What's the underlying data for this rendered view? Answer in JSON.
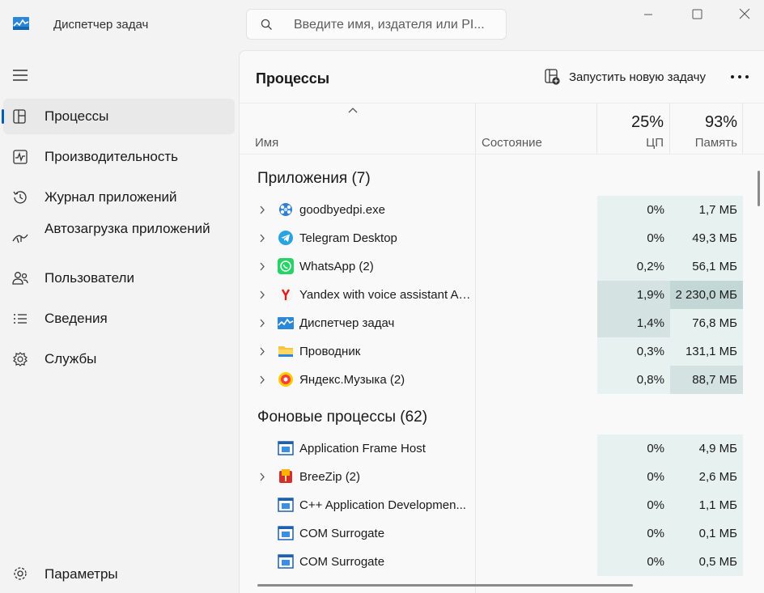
{
  "window": {
    "title": "Диспетчер задач",
    "search_placeholder": "Введите имя, издателя или PI..."
  },
  "sidebar": {
    "items": [
      {
        "label": "Процессы",
        "icon": "processes-icon",
        "active": true
      },
      {
        "label": "Производительность",
        "icon": "performance-icon"
      },
      {
        "label": "Журнал приложений",
        "icon": "app-history-icon"
      },
      {
        "label": "Автозагрузка приложений",
        "icon": "startup-icon"
      },
      {
        "label": "Пользователи",
        "icon": "users-icon"
      },
      {
        "label": "Сведения",
        "icon": "details-icon"
      },
      {
        "label": "Службы",
        "icon": "services-icon"
      }
    ],
    "settings_label": "Параметры"
  },
  "main": {
    "title": "Процессы",
    "run_task_label": "Запустить новую задачу",
    "columns": {
      "name": "Имя",
      "status": "Состояние",
      "cpu_percent": "25%",
      "cpu_label": "ЦП",
      "mem_percent": "93%",
      "mem_label": "Память"
    },
    "groups": {
      "apps": "Приложения (7)",
      "background": "Фоновые процессы (62)"
    },
    "apps": [
      {
        "name": "goodbyedpi.exe",
        "cpu": "0%",
        "mem": "1,7 МБ",
        "icon": "goodbyedpi-icon"
      },
      {
        "name": "Telegram Desktop",
        "cpu": "0%",
        "mem": "49,3 МБ",
        "icon": "telegram-icon"
      },
      {
        "name": "WhatsApp (2)",
        "cpu": "0,2%",
        "mem": "56,1 МБ",
        "icon": "whatsapp-icon"
      },
      {
        "name": "Yandex with voice assistant Ali...",
        "cpu": "1,9%",
        "mem": "2 230,0 МБ",
        "icon": "yandex-browser-icon"
      },
      {
        "name": "Диспетчер задач",
        "cpu": "1,4%",
        "mem": "76,8 МБ",
        "icon": "task-manager-icon"
      },
      {
        "name": "Проводник",
        "cpu": "0,3%",
        "mem": "131,1 МБ",
        "icon": "explorer-folder-icon"
      },
      {
        "name": "Яндекс.Музыка (2)",
        "cpu": "0,8%",
        "mem": "88,7 МБ",
        "icon": "yandex-music-icon"
      }
    ],
    "background": [
      {
        "name": "Application Frame Host",
        "cpu": "0%",
        "mem": "4,9 МБ",
        "icon": "app-window-icon"
      },
      {
        "name": "BreeZip (2)",
        "cpu": "0%",
        "mem": "2,6 МБ",
        "icon": "breezip-icon"
      },
      {
        "name": "C++ Application Developmen...",
        "cpu": "0%",
        "mem": "1,1 МБ",
        "icon": "app-window-icon"
      },
      {
        "name": "COM Surrogate",
        "cpu": "0%",
        "mem": "0,1 МБ",
        "icon": "app-window-icon"
      },
      {
        "name": "COM Surrogate",
        "cpu": "0%",
        "mem": "0,5 МБ",
        "icon": "app-window-icon"
      }
    ]
  }
}
